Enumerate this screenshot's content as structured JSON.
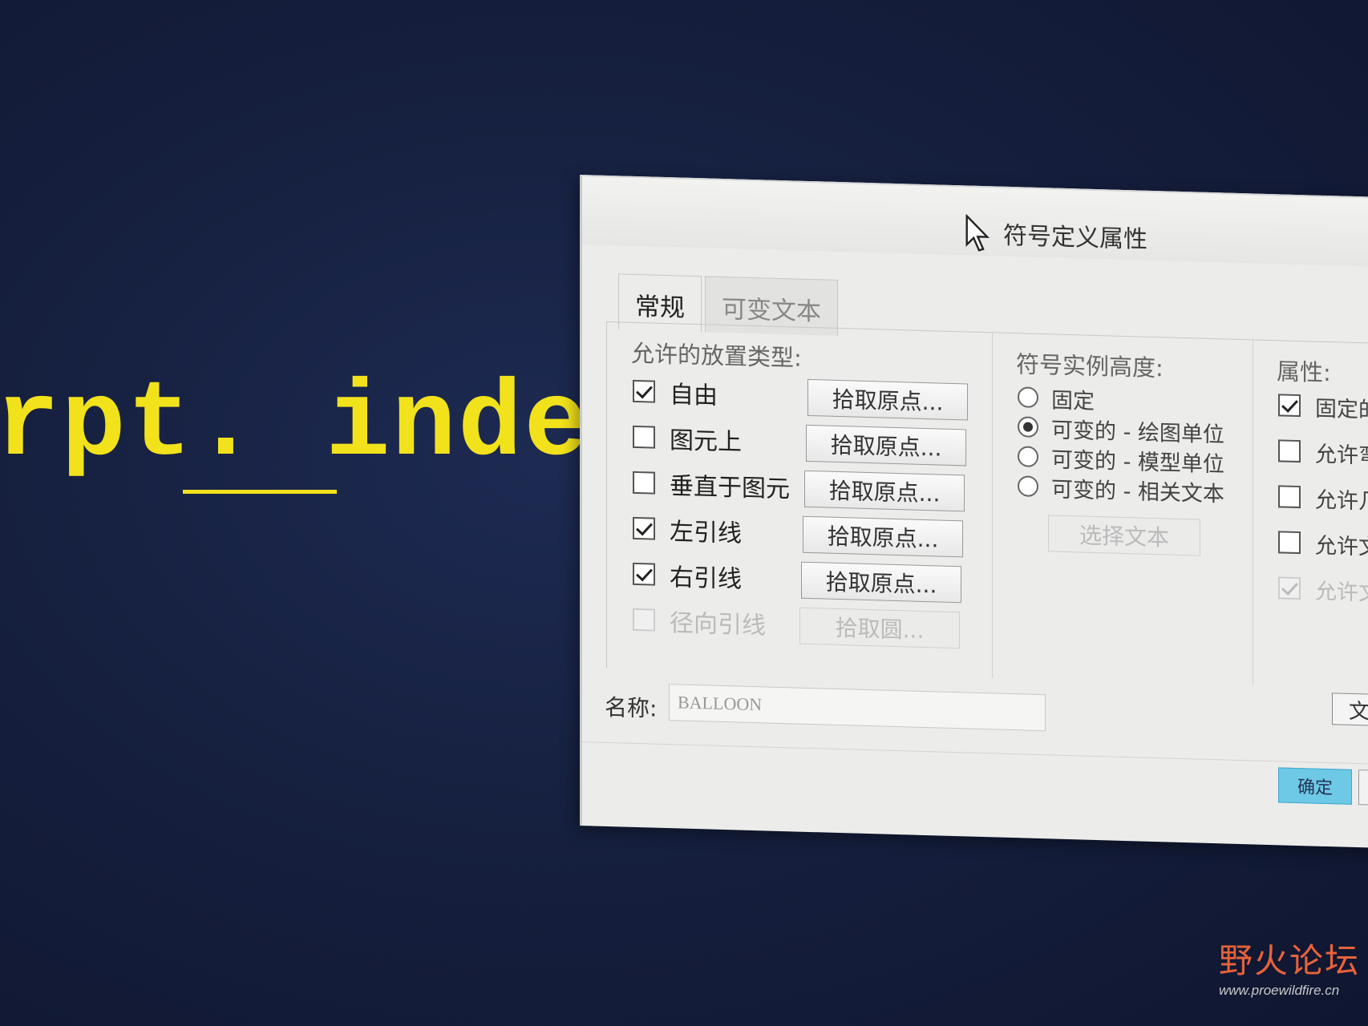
{
  "background": {
    "code_text": "rpt. index\\"
  },
  "dialog": {
    "title": "符号定义属性",
    "tabs": [
      "常规",
      "可变文本"
    ],
    "placement": {
      "label": "允许的放置类型:",
      "options": [
        {
          "label": "自由",
          "checked": true,
          "disabled": false,
          "button": "拾取原点..."
        },
        {
          "label": "图元上",
          "checked": false,
          "disabled": false,
          "button": "拾取原点..."
        },
        {
          "label": "垂直于图元",
          "checked": false,
          "disabled": false,
          "button": "拾取原点..."
        },
        {
          "label": "左引线",
          "checked": true,
          "disabled": false,
          "button": "拾取原点..."
        },
        {
          "label": "右引线",
          "checked": true,
          "disabled": false,
          "button": "拾取原点..."
        },
        {
          "label": "径向引线",
          "checked": false,
          "disabled": true,
          "button": "拾取圆..."
        }
      ]
    },
    "height": {
      "label": "符号实例高度:",
      "options": [
        {
          "label": "固定",
          "selected": false
        },
        {
          "label": "可变的 - 绘图单位",
          "selected": true
        },
        {
          "label": "可变的 - 模型单位",
          "selected": false
        },
        {
          "label": "可变的 - 相关文本",
          "selected": false
        }
      ],
      "select_text_button": "选择文本"
    },
    "attributes": {
      "label": "属性:",
      "options": [
        {
          "label": "固定的",
          "checked": true,
          "disabled": false
        },
        {
          "label": "允许弯",
          "checked": false,
          "disabled": false
        },
        {
          "label": "允许几何",
          "checked": false,
          "disabled": false
        },
        {
          "label": "允许文本",
          "checked": false,
          "disabled": false
        },
        {
          "label": "允许文本",
          "checked": true,
          "disabled": true
        }
      ]
    },
    "name_label": "名称:",
    "name_value": "BALLOON",
    "text_button": "文本",
    "ok_button": "确定"
  },
  "watermark": {
    "main": "野火论坛",
    "sub": "www.proewildfire.cn"
  },
  "colors": {
    "background": "#16203f",
    "code_text": "#f2e21b",
    "ok_button": "#6ec9e6",
    "watermark": "#e8623a"
  }
}
